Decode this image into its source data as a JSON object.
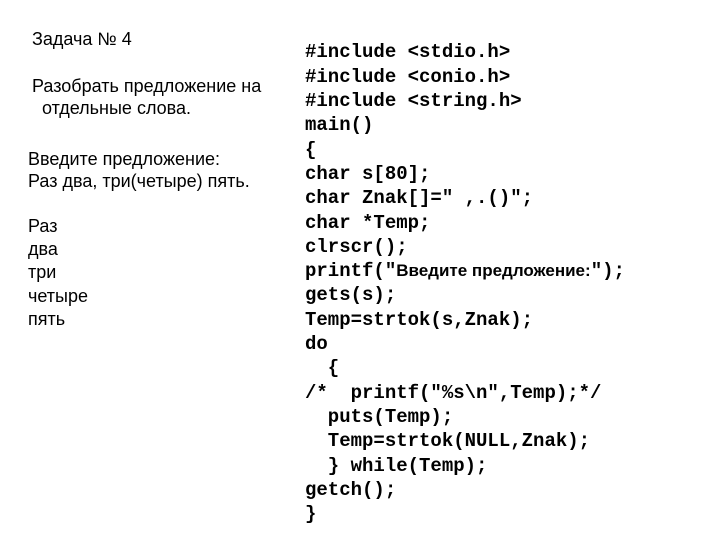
{
  "left": {
    "title": "Задача № 4",
    "problem_l1": "Разобрать предложение на",
    "problem_l2": "отдельные слова.",
    "io_prompt": "Введите предложение:",
    "io_input": "Раз два, три(четыре) пять.",
    "words": [
      "Раз",
      "два",
      "три",
      "четыре",
      "пять"
    ]
  },
  "code": {
    "l01": "#include <stdio.h>",
    "l02": "#include <conio.h>",
    "l03": "#include <string.h>",
    "l04": "main()",
    "l05": "{",
    "l06": "char s[80];",
    "l07": "char Znak[]=\" ,.()\";",
    "l08": "char *Temp;",
    "l09": "clrscr();",
    "l10a": "printf(\"",
    "l10b": "Введите предложение:",
    "l10c": "\");",
    "l11": "gets(s);",
    "l12": "Temp=strtok(s,Znak);",
    "l13": "do",
    "l14": "  {",
    "l15": "/*  printf(\"%s\\n\",Temp);*/",
    "l16": "  puts(Temp);",
    "l17": "  Temp=strtok(NULL,Znak);",
    "l18": "  } while(Temp);",
    "l19": "getch();",
    "l20": "}"
  }
}
